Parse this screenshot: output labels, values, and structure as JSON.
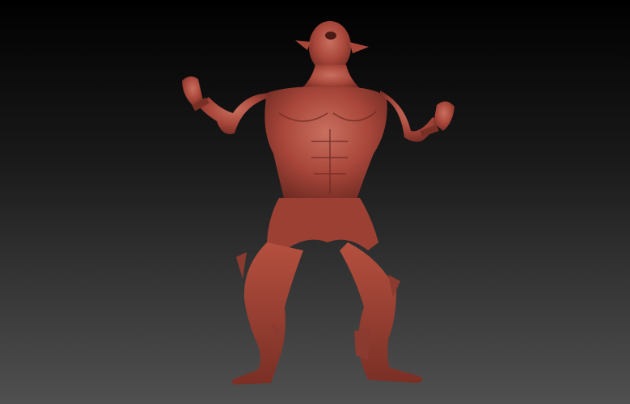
{
  "scene": {
    "description_hidden": "",
    "material_color": "#a8463a",
    "material_shadow": "#6e2a22",
    "material_highlight": "#c9705f",
    "background_top": "#000000",
    "background_bottom": "#505050"
  }
}
